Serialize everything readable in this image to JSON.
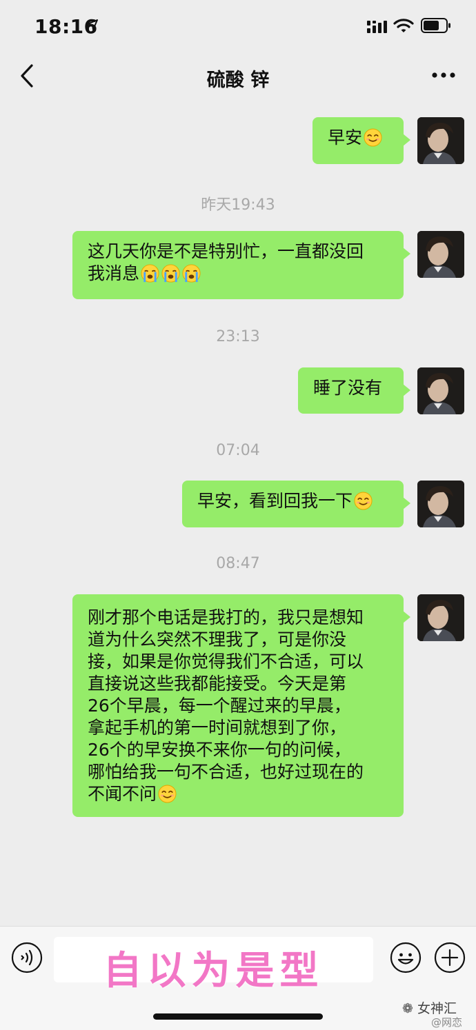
{
  "status_bar": {
    "time": "18:16"
  },
  "header": {
    "title": "硫酸 锌"
  },
  "messages": [
    {
      "type": "message",
      "text": "早安",
      "emoji": "smile"
    },
    {
      "type": "time",
      "text": "昨天19:43"
    },
    {
      "type": "message",
      "lines": [
        "这几天你是不是特别忙，一直都没回",
        "我消息"
      ],
      "emoji": "cry-x3"
    },
    {
      "type": "time",
      "text": "23:13"
    },
    {
      "type": "message",
      "text": "睡了没有"
    },
    {
      "type": "time",
      "text": "07:04"
    },
    {
      "type": "message",
      "text": "早安，看到回我一下",
      "emoji": "smile"
    },
    {
      "type": "time",
      "text": "08:47"
    },
    {
      "type": "message",
      "lines": [
        "刚才那个电话是我打的，我只是想知",
        "道为什么突然不理我了，可是你没",
        "接，如果是你觉得我们不合适，可以",
        "直接说这些我都能接受。今天是第",
        "26个早晨，每一个醒过来的早晨，",
        "拿起手机的第一时间就想到了你，",
        "26个的早安换不来你一句的问候，",
        "哪怕给我一句不合适，也好过现在的",
        "不闻不问"
      ],
      "emoji": "smile"
    }
  ],
  "input_bar": {
    "overlay_text": "自以为是型"
  },
  "watermark": {
    "source": "女神汇",
    "weibo": "@网恋"
  },
  "colors": {
    "background": "#ededed",
    "bubble": "#95ec69",
    "timestamp": "#a8a8a8",
    "overlay": "#f277c6"
  },
  "icons": [
    "location-arrow-icon",
    "signal-icon",
    "wifi-icon",
    "battery-icon",
    "back-icon",
    "more-icon",
    "voice-icon",
    "emoji-icon",
    "plus-icon",
    "smile-emoji",
    "crying-emoji"
  ]
}
